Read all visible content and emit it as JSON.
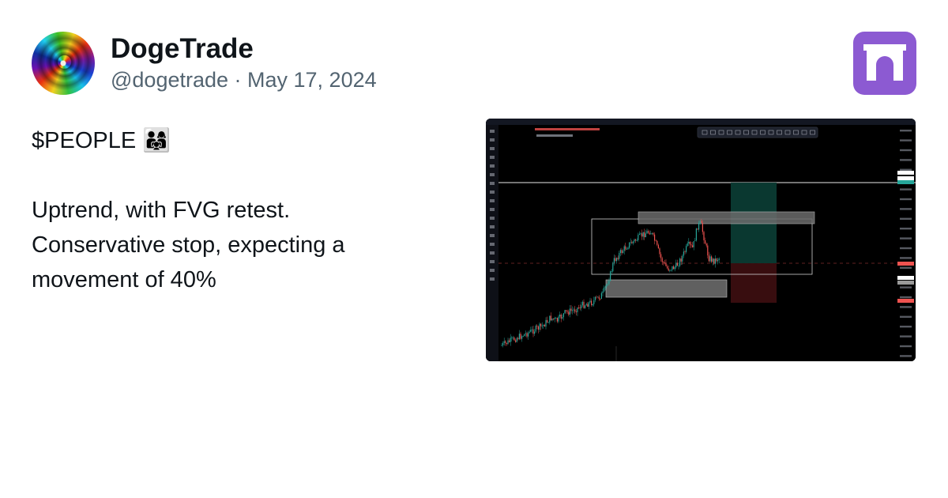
{
  "author": {
    "display_name": "DogeTrade",
    "handle": "@dogetrade",
    "separator": " · ",
    "date": "May 17, 2024"
  },
  "tweet": {
    "lines": [
      "$PEOPLE 👨‍👩‍👧",
      "",
      "Uptrend, with FVG retest.",
      "Conservative stop, expecting a",
      "movement of 40%"
    ]
  },
  "brand": {
    "logo": "arch-logo-icon",
    "color": "#8c5ad2"
  },
  "media": {
    "type": "trading-chart-screenshot",
    "theme": "dark",
    "candle_up_color": "#26a69a",
    "candle_down_color": "#ef5350"
  }
}
